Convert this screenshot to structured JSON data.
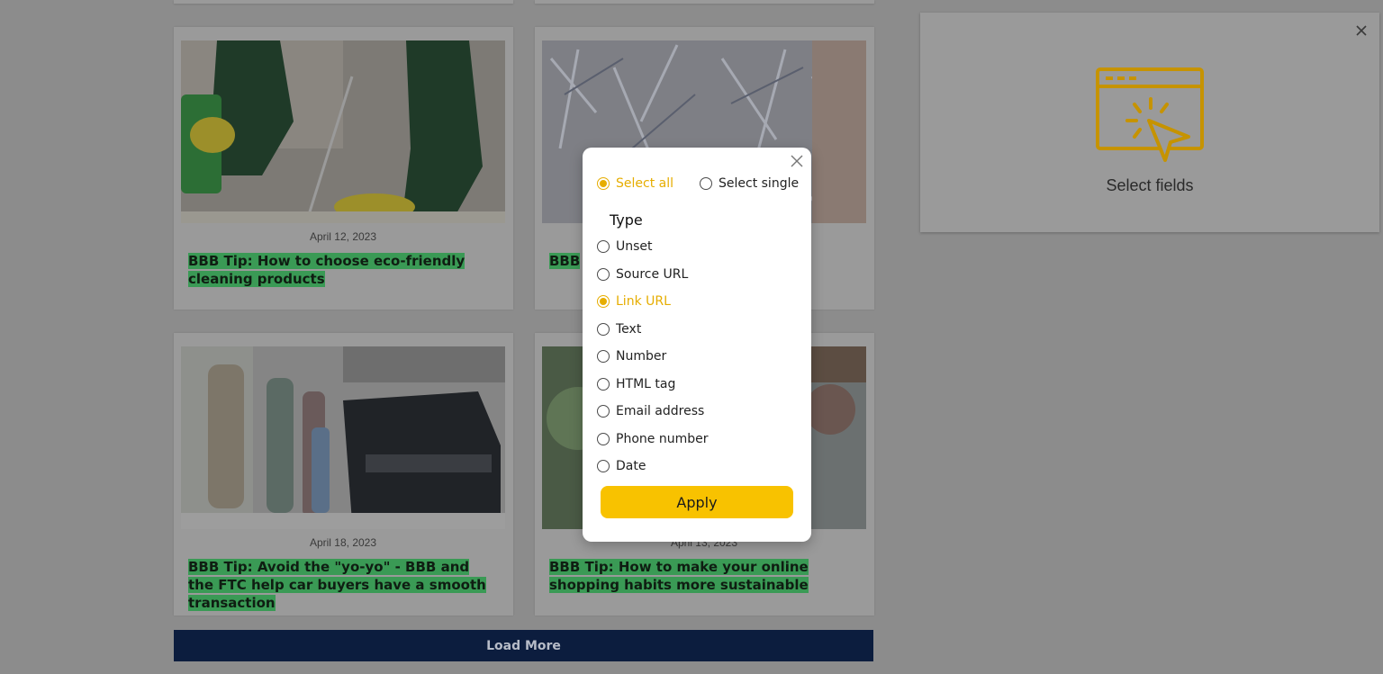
{
  "articles": [
    {
      "date": "April 12, 2023",
      "title": "BBB Tip: How to choose eco-friendly cleaning products"
    },
    {
      "date": "",
      "title": "BBB"
    },
    {
      "date": "April 18, 2023",
      "title": "BBB Tip: Avoid the \"yo-yo\" - BBB and the FTC help car buyers have a smooth transaction"
    },
    {
      "date": "April 13, 2023",
      "title": "BBB Tip: How to make your online shopping habits more sustainable"
    }
  ],
  "load_more_label": "Load More",
  "panel": {
    "label": "Select fields",
    "icon": "cursor-click-window-icon",
    "accent": "#c69300"
  },
  "modal": {
    "mode_options": [
      {
        "label": "Select all",
        "checked": true
      },
      {
        "label": "Select single",
        "checked": false
      }
    ],
    "type_heading": "Type",
    "type_options": [
      {
        "label": "Unset",
        "checked": false
      },
      {
        "label": "Source URL",
        "checked": false
      },
      {
        "label": "Link URL",
        "checked": true
      },
      {
        "label": "Text",
        "checked": false
      },
      {
        "label": "Number",
        "checked": false
      },
      {
        "label": "HTML tag",
        "checked": false
      },
      {
        "label": "Email address",
        "checked": false
      },
      {
        "label": "Phone number",
        "checked": false
      },
      {
        "label": "Date",
        "checked": false
      }
    ],
    "apply_label": "Apply",
    "accent": "#f8c200"
  }
}
